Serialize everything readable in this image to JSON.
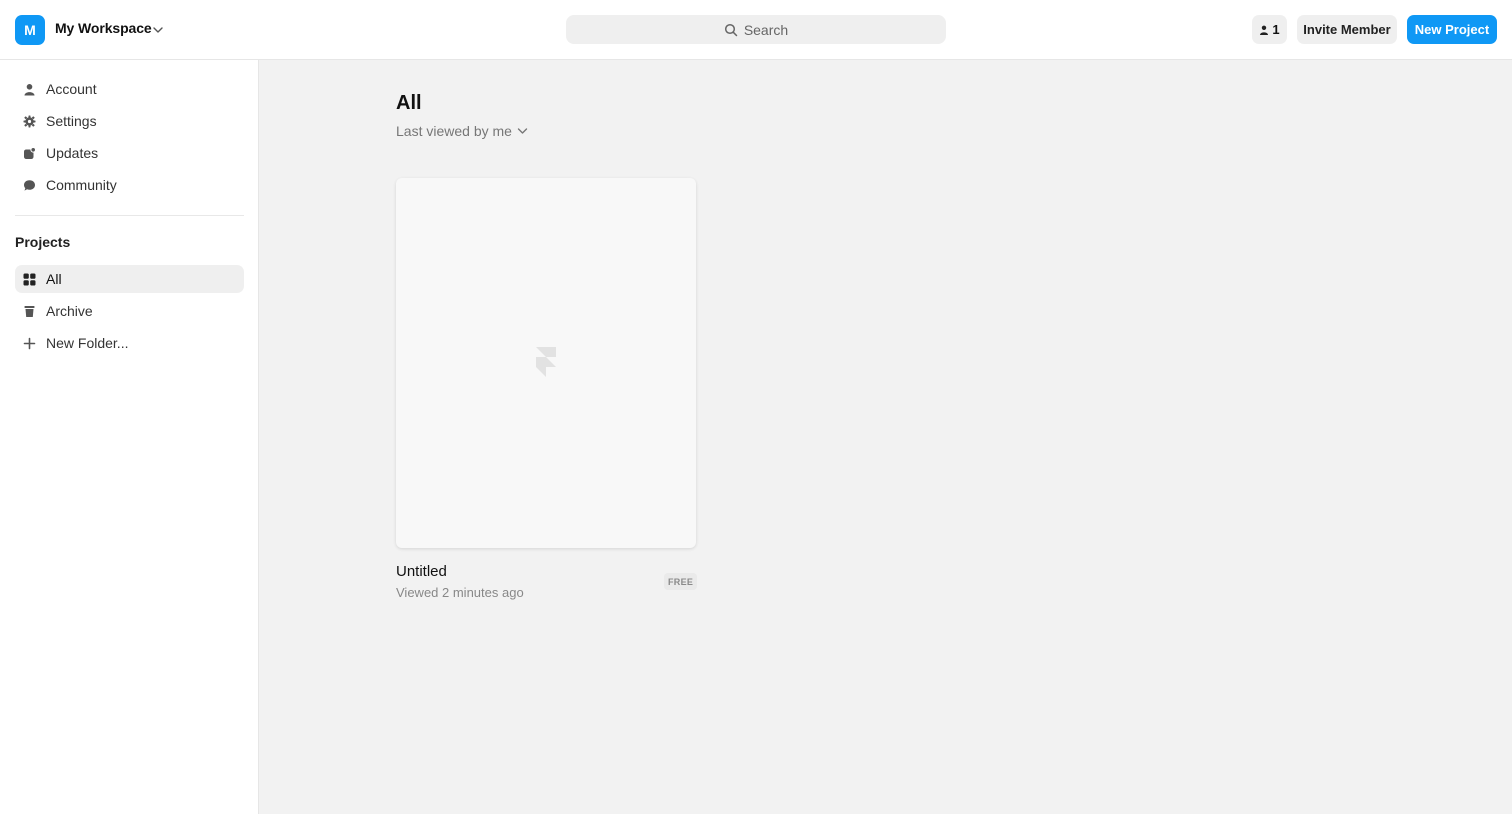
{
  "workspace": {
    "initial": "M",
    "name": "My Workspace"
  },
  "search": {
    "placeholder": "Search"
  },
  "header": {
    "member_count": "1",
    "invite_label": "Invite Member",
    "new_project_label": "New Project"
  },
  "sidebar": {
    "items": [
      {
        "label": "Account",
        "icon": "user-icon"
      },
      {
        "label": "Settings",
        "icon": "gear-icon"
      },
      {
        "label": "Updates",
        "icon": "updates-icon"
      },
      {
        "label": "Community",
        "icon": "chat-bubble-icon"
      }
    ],
    "projects_label": "Projects",
    "project_items": [
      {
        "label": "All",
        "icon": "grid-icon",
        "active": true
      },
      {
        "label": "Archive",
        "icon": "trash-icon"
      },
      {
        "label": "New Folder...",
        "icon": "plus-icon"
      }
    ]
  },
  "main": {
    "title": "All",
    "sort_label": "Last viewed by me",
    "projects": [
      {
        "title": "Untitled",
        "meta": "Viewed 2 minutes ago",
        "badge": "FREE"
      }
    ]
  },
  "colors": {
    "accent": "#0f98f5",
    "background": "#f2f2f2",
    "surface": "#ffffff"
  }
}
